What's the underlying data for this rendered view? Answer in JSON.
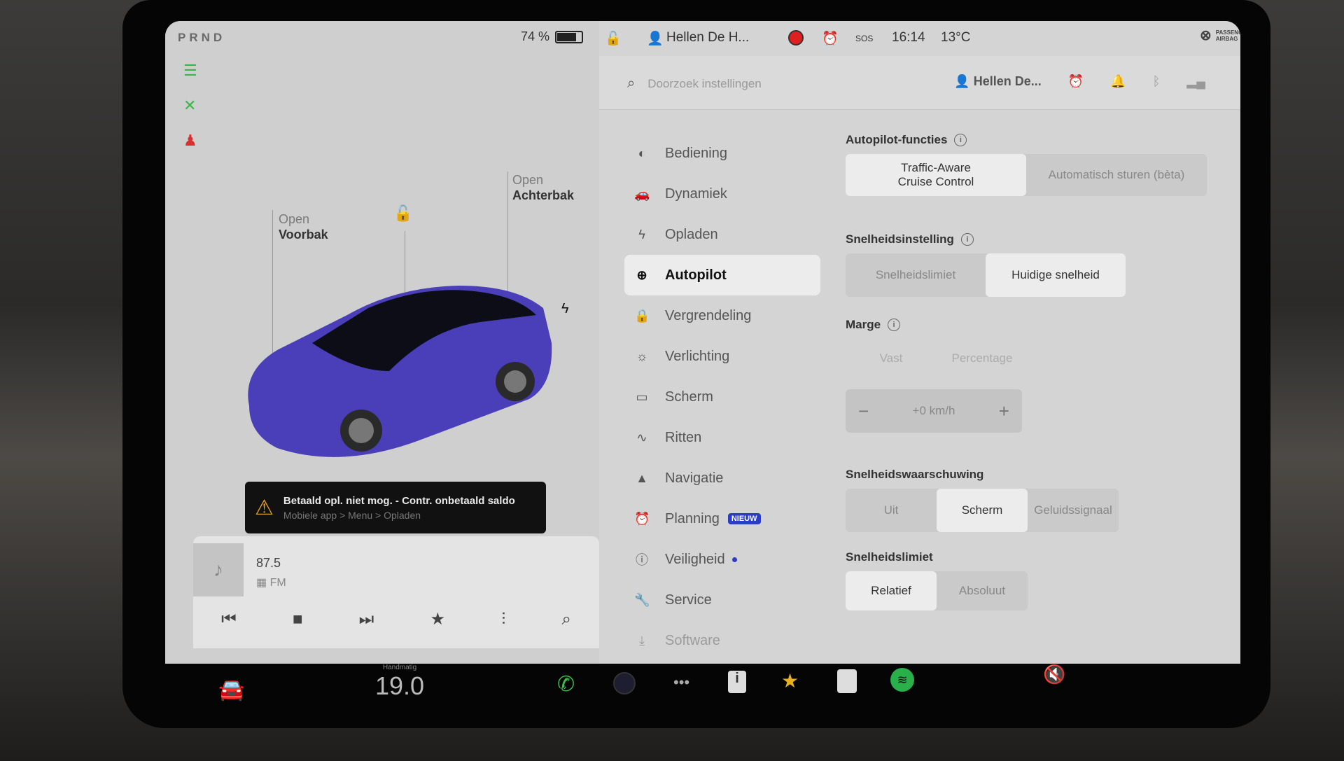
{
  "status": {
    "gear": "PRND",
    "battery_percent_label": "74 %",
    "battery_level": 0.74,
    "profile_name": "Hellen De H...",
    "time": "16:14",
    "temperature": "13°C",
    "sos_label": "SOS",
    "airbag_label_line1": "PASSENGER",
    "airbag_label_line2": "AIRBAG"
  },
  "car": {
    "frunk_small": "Open",
    "frunk_big": "Voorbak",
    "trunk_small": "Open",
    "trunk_big": "Achterbak",
    "paint_color": "#4a3fb8"
  },
  "alert": {
    "title": "Betaald opl. niet mog. - Contr. onbetaald saldo",
    "subtitle": "Mobiele app > Menu > Opladen"
  },
  "media": {
    "frequency": "87.5",
    "band": "FM"
  },
  "settings_header": {
    "search_placeholder": "Doorzoek instellingen",
    "profile_short": "Hellen De..."
  },
  "menu": {
    "items": [
      {
        "label": "Bediening",
        "icon": "toggle-icon"
      },
      {
        "label": "Dynamiek",
        "icon": "car-icon"
      },
      {
        "label": "Opladen",
        "icon": "bolt-icon"
      },
      {
        "label": "Autopilot",
        "icon": "steering-wheel-icon",
        "active": true
      },
      {
        "label": "Vergrendeling",
        "icon": "lock-icon"
      },
      {
        "label": "Verlichting",
        "icon": "light-icon"
      },
      {
        "label": "Scherm",
        "icon": "display-icon"
      },
      {
        "label": "Ritten",
        "icon": "trips-icon"
      },
      {
        "label": "Navigatie",
        "icon": "navigation-icon"
      },
      {
        "label": "Planning",
        "icon": "alarm-icon",
        "badge": "NIEUW"
      },
      {
        "label": "Veiligheid",
        "icon": "alert-icon",
        "dot": true
      },
      {
        "label": "Service",
        "icon": "wrench-icon"
      },
      {
        "label": "Software",
        "icon": "download-icon"
      }
    ]
  },
  "autopilot": {
    "features_title": "Autopilot-functies",
    "features_options": [
      "Traffic-Aware\nCruise Control",
      "Automatisch sturen (bèta)"
    ],
    "features_selected": 0,
    "speed_setting_title": "Snelheidsinstelling",
    "speed_setting_options": [
      "Snelheidslimiet",
      "Huidige snelheid"
    ],
    "speed_setting_selected": 1,
    "margin_title": "Marge",
    "margin_options": [
      "Vast",
      "Percentage"
    ],
    "margin_value": "+0 km/h",
    "warning_title": "Snelheidswaarschuwing",
    "warning_options": [
      "Uit",
      "Scherm",
      "Geluidssignaal"
    ],
    "warning_selected": 1,
    "limit_title": "Snelheidslimiet",
    "limit_options": [
      "Relatief",
      "Absoluut"
    ],
    "limit_selected": 0
  },
  "dock": {
    "climate_mode": "Handmatig",
    "climate_temp": "19.0"
  }
}
